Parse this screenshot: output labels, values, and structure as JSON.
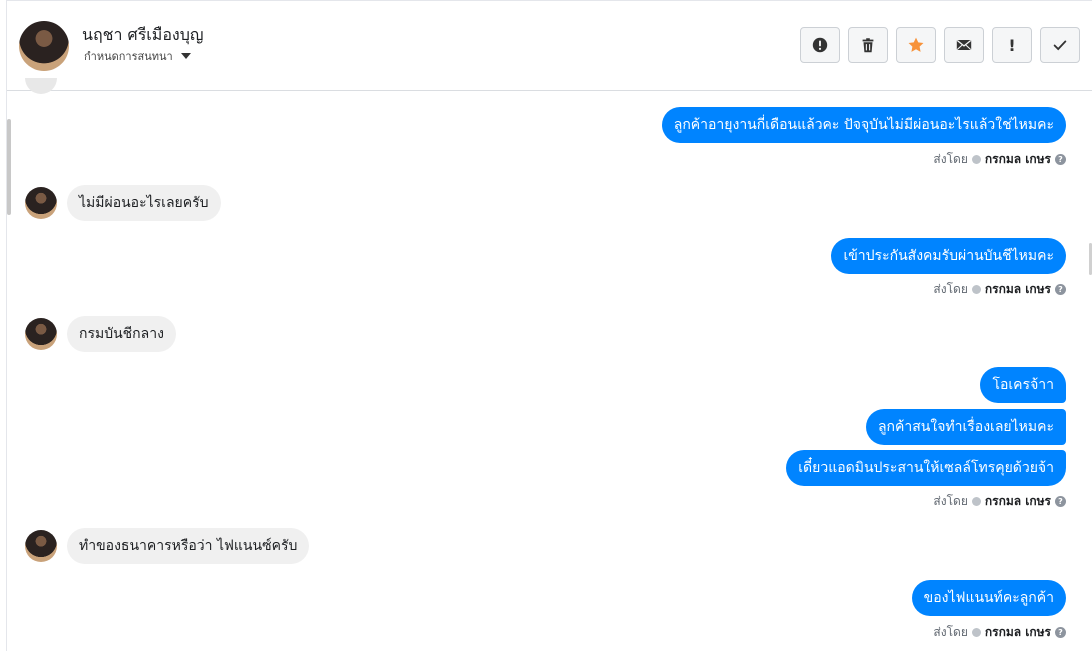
{
  "header": {
    "contact_name": "นฤชา ศรีเมืองบุญ",
    "conversation_setting": "กำหนดการสนทนา",
    "toolbar": [
      {
        "icon": "alert-circle-icon"
      },
      {
        "icon": "trash-icon"
      },
      {
        "icon": "star-icon",
        "color": "#f7923a"
      },
      {
        "icon": "envelope-icon"
      },
      {
        "icon": "exclamation-icon",
        "label": "!"
      },
      {
        "icon": "check-icon"
      }
    ]
  },
  "sent_by_label": "ส่งโดย",
  "agent_name": "กรกมล เกษร",
  "messages": [
    {
      "dir": "out",
      "text": "ลูกค้าอายุงานกี่เดือนแล้วคะ ปัจจุบันไม่มีผ่อนอะไรแล้วใช่ไหมคะ"
    },
    {
      "dir": "in",
      "text": "ไม่มีผ่อนอะไรเลยครับ"
    },
    {
      "dir": "out",
      "text": "เข้าประกันสังคมรับผ่านบันชีไหมคะ"
    },
    {
      "dir": "in",
      "text": "กรมบันชีกลาง"
    },
    {
      "dir": "out",
      "text": "โอเครจ้าา"
    },
    {
      "dir": "out",
      "text": "ลูกค้าสนใจทำเรื่องเลยไหมคะ"
    },
    {
      "dir": "out",
      "text": "เดี๋ยวแอดมินประสานให้เซลล์โทรคุยด้วยจ้า"
    },
    {
      "dir": "in",
      "text": "ทำของธนาคารหรือว่า ไฟแนนซ์ครับ"
    },
    {
      "dir": "out",
      "text": "ของไฟแนนท์คะลูกค้า"
    }
  ],
  "colors": {
    "outgoing_bubble": "#0084ff",
    "incoming_bubble": "#f0f0f0"
  }
}
